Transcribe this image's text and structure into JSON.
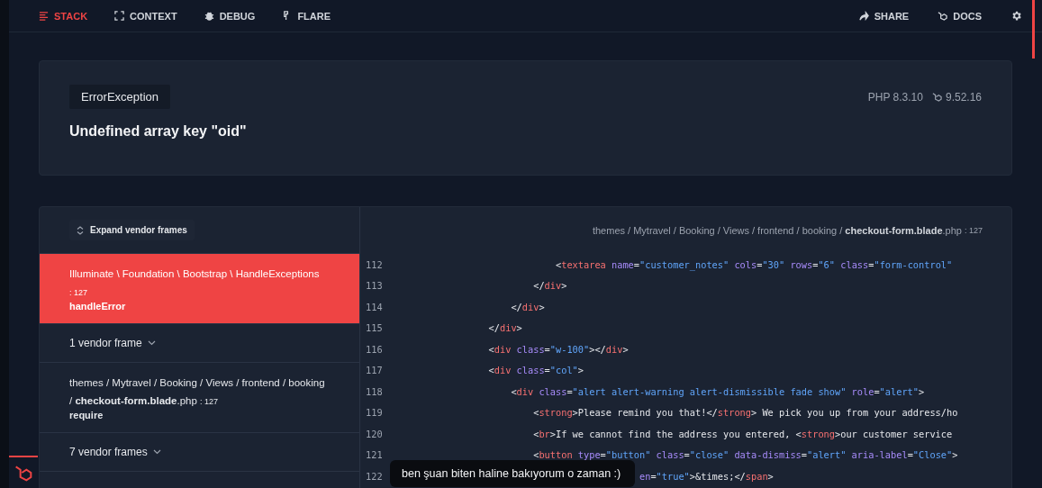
{
  "nav": {
    "tabs": [
      {
        "label": "STACK",
        "selected": true
      },
      {
        "label": "CONTEXT",
        "selected": false
      },
      {
        "label": "DEBUG",
        "selected": false
      },
      {
        "label": "FLARE",
        "selected": false
      }
    ],
    "actions": [
      {
        "label": "SHARE"
      },
      {
        "label": "DOCS"
      }
    ]
  },
  "error": {
    "type": "ErrorException",
    "message": "Undefined array key \"oid\"",
    "php_version": "PHP 8.3.10",
    "laravel_version": "9.52.16"
  },
  "frames": {
    "expand_button": "Expand vendor frames",
    "items": [
      {
        "kind": "frame",
        "selected": true,
        "path": "Illuminate \\ Foundation \\ Bootstrap \\ HandleExceptions",
        "line": ": 127",
        "method": "handleError"
      },
      {
        "kind": "vendor",
        "label": "1 vendor frame"
      },
      {
        "kind": "frame",
        "selected": false,
        "path": "themes / Mytravel / Booking / Views / frontend / booking",
        "file": "/ **checkout-form.blade**.php",
        "line": ": 127",
        "method": "require"
      },
      {
        "kind": "vendor",
        "label": "7 vendor frames"
      }
    ]
  },
  "code": {
    "file": "themes / Mytravel / Booking / Views / frontend / booking / **checkout-form.blade**.php",
    "line": ": 127",
    "lines": [
      {
        "number": "112",
        "tokens": [
          {
            "kind": "punct",
            "text": "                              <"
          },
          {
            "kind": "tag",
            "text": "textarea"
          },
          {
            "kind": "attr",
            "text": " name"
          },
          {
            "kind": "punct",
            "text": "="
          },
          {
            "kind": "str",
            "text": "\"customer_notes\""
          },
          {
            "kind": "attr",
            "text": " cols"
          },
          {
            "kind": "punct",
            "text": "="
          },
          {
            "kind": "str",
            "text": "\"30\""
          },
          {
            "kind": "attr",
            "text": " rows"
          },
          {
            "kind": "punct",
            "text": "="
          },
          {
            "kind": "str",
            "text": "\"6\""
          },
          {
            "kind": "attr",
            "text": " class"
          },
          {
            "kind": "punct",
            "text": "="
          },
          {
            "kind": "str",
            "text": "\"form-control\""
          }
        ]
      },
      {
        "number": "113",
        "tokens": [
          {
            "kind": "punct",
            "text": "                          </"
          },
          {
            "kind": "tag",
            "text": "div"
          },
          {
            "kind": "punct",
            "text": ">"
          }
        ]
      },
      {
        "number": "114",
        "tokens": [
          {
            "kind": "punct",
            "text": "                      </"
          },
          {
            "kind": "tag",
            "text": "div"
          },
          {
            "kind": "punct",
            "text": ">"
          }
        ]
      },
      {
        "number": "115",
        "tokens": [
          {
            "kind": "punct",
            "text": "                  </"
          },
          {
            "kind": "tag",
            "text": "div"
          },
          {
            "kind": "punct",
            "text": ">"
          }
        ]
      },
      {
        "number": "116",
        "tokens": [
          {
            "kind": "punct",
            "text": "                  <"
          },
          {
            "kind": "tag",
            "text": "div"
          },
          {
            "kind": "attr",
            "text": " class"
          },
          {
            "kind": "punct",
            "text": "="
          },
          {
            "kind": "str",
            "text": "\"w-100\""
          },
          {
            "kind": "punct",
            "text": "></"
          },
          {
            "kind": "tag",
            "text": "div"
          },
          {
            "kind": "punct",
            "text": ">"
          }
        ]
      },
      {
        "number": "117",
        "tokens": [
          {
            "kind": "punct",
            "text": "                  <"
          },
          {
            "kind": "tag",
            "text": "div"
          },
          {
            "kind": "attr",
            "text": " class"
          },
          {
            "kind": "punct",
            "text": "="
          },
          {
            "kind": "str",
            "text": "\"col\""
          },
          {
            "kind": "punct",
            "text": ">"
          }
        ]
      },
      {
        "number": "118",
        "tokens": [
          {
            "kind": "punct",
            "text": "                      <"
          },
          {
            "kind": "tag",
            "text": "div"
          },
          {
            "kind": "attr",
            "text": " class"
          },
          {
            "kind": "punct",
            "text": "="
          },
          {
            "kind": "str",
            "text": "\"alert alert-warning alert-dismissible fade show\""
          },
          {
            "kind": "attr",
            "text": " role"
          },
          {
            "kind": "punct",
            "text": "="
          },
          {
            "kind": "str",
            "text": "\"alert\""
          },
          {
            "kind": "punct",
            "text": ">"
          }
        ]
      },
      {
        "number": "119",
        "tokens": [
          {
            "kind": "punct",
            "text": "                          <"
          },
          {
            "kind": "tag",
            "text": "strong"
          },
          {
            "kind": "punct",
            "text": ">"
          },
          {
            "kind": "text",
            "text": "Please remind you that!"
          },
          {
            "kind": "punct",
            "text": "</"
          },
          {
            "kind": "tag",
            "text": "strong"
          },
          {
            "kind": "punct",
            "text": ">"
          },
          {
            "kind": "text",
            "text": " We pick you up from your address/ho"
          }
        ]
      },
      {
        "number": "120",
        "tokens": [
          {
            "kind": "punct",
            "text": "                          <"
          },
          {
            "kind": "tag",
            "text": "br"
          },
          {
            "kind": "punct",
            "text": ">"
          },
          {
            "kind": "text",
            "text": "If we cannot find the address you entered, "
          },
          {
            "kind": "punct",
            "text": "<"
          },
          {
            "kind": "tag",
            "text": "strong"
          },
          {
            "kind": "punct",
            "text": ">"
          },
          {
            "kind": "text",
            "text": "our customer service"
          }
        ]
      },
      {
        "number": "121",
        "tokens": [
          {
            "kind": "punct",
            "text": "                          <"
          },
          {
            "kind": "tag",
            "text": "button"
          },
          {
            "kind": "attr",
            "text": " type"
          },
          {
            "kind": "punct",
            "text": "="
          },
          {
            "kind": "str",
            "text": "\"button\""
          },
          {
            "kind": "attr",
            "text": " class"
          },
          {
            "kind": "punct",
            "text": "="
          },
          {
            "kind": "str",
            "text": "\"close\""
          },
          {
            "kind": "attr",
            "text": " data-dismiss"
          },
          {
            "kind": "punct",
            "text": "="
          },
          {
            "kind": "str",
            "text": "\"alert\""
          },
          {
            "kind": "attr",
            "text": " aria-label"
          },
          {
            "kind": "punct",
            "text": "="
          },
          {
            "kind": "str",
            "text": "\"Close\""
          },
          {
            "kind": "punct",
            "text": ">"
          }
        ]
      },
      {
        "number": "122",
        "tokens": [
          {
            "kind": "attr",
            "text": "                                             en"
          },
          {
            "kind": "punct",
            "text": "="
          },
          {
            "kind": "str",
            "text": "\"true\""
          },
          {
            "kind": "punct",
            "text": ">&times;</"
          },
          {
            "kind": "tag",
            "text": "span"
          },
          {
            "kind": "punct",
            "text": ">"
          }
        ]
      }
    ]
  },
  "caption": "ben şuan biten haline bakıyorum o zaman :)"
}
